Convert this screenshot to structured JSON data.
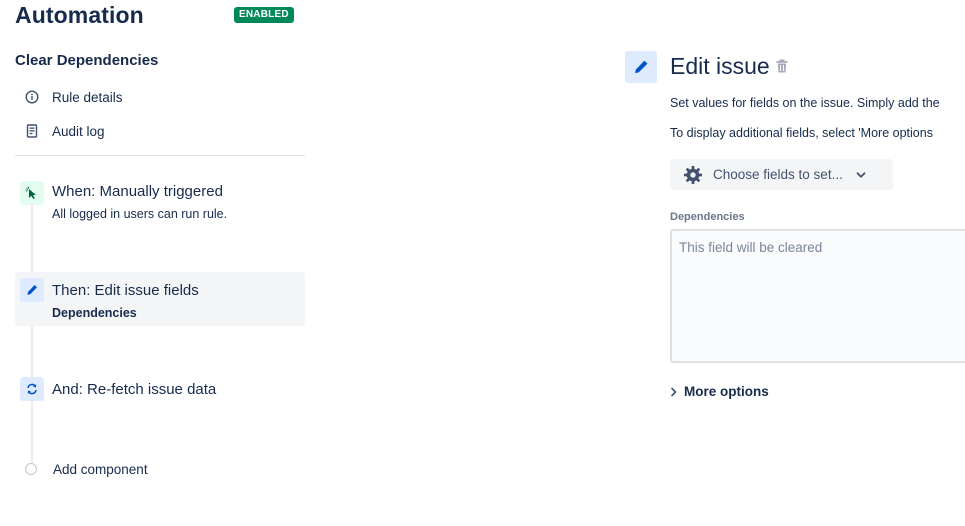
{
  "header": {
    "title": "Automation",
    "status_badge": "ENABLED"
  },
  "sidebar": {
    "rule_name": "Clear Dependencies",
    "links": [
      {
        "label": "Rule details",
        "icon": "info-icon"
      },
      {
        "label": "Audit log",
        "icon": "document-icon"
      }
    ],
    "steps": [
      {
        "title": "When: Manually triggered",
        "subtitle": "All logged in users can run rule.",
        "icon": "cursor-click-icon",
        "color": "#e3fcef"
      },
      {
        "title": "Then: Edit issue fields",
        "subtitle": "Dependencies",
        "icon": "pencil-icon",
        "color": "#deebff",
        "selected": true
      },
      {
        "title": "And: Re-fetch issue data",
        "subtitle": "",
        "icon": "refresh-icon",
        "color": "#deebff"
      }
    ],
    "add_component": "Add component"
  },
  "editor": {
    "title": "Edit issue",
    "help_line_1": "Set values for fields on the issue. Simply add the",
    "help_line_2": "To display additional fields, select 'More options",
    "choose_fields_button": "Choose fields to set...",
    "field": {
      "label": "Dependencies",
      "placeholder": "This field will be cleared"
    },
    "more_options": "More options"
  },
  "colors": {
    "enabled_green": "#00875a",
    "primary_blue": "#0052cc",
    "text": "#172b4d"
  }
}
